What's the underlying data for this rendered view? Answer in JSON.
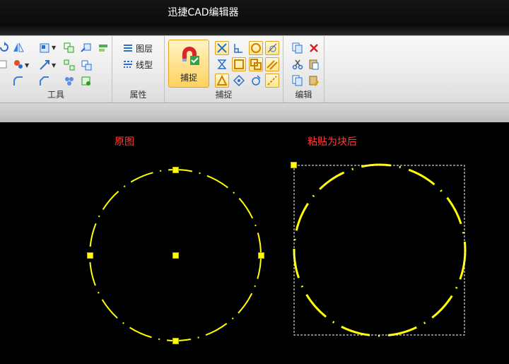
{
  "window": {
    "title": "迅捷CAD编辑器"
  },
  "ribbon": {
    "groups": [
      {
        "label": "工具"
      },
      {
        "label": "属性",
        "items": [
          "图层",
          "线型"
        ]
      },
      {
        "label": "捕捉",
        "main_button": "捕捉"
      },
      {
        "label": "编辑"
      }
    ]
  },
  "canvas": {
    "background": "#000000",
    "label_original": "原图",
    "label_block": "粘贴为块后",
    "accent_yellow": "#ffff00",
    "label_red": "#ff3b3b"
  }
}
